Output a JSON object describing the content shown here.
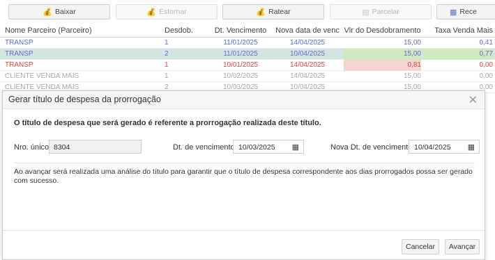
{
  "toolbar": {
    "buttons": [
      {
        "label": "Baixar",
        "icon": "money-bag-icon",
        "enabled": true
      },
      {
        "label": "Estornar",
        "icon": "money-bag-icon",
        "enabled": false
      },
      {
        "label": "Ratear",
        "icon": "money-bag-icon",
        "enabled": true
      },
      {
        "label": "Parcelar",
        "icon": "document-icon",
        "enabled": false
      },
      {
        "label": "Rece",
        "icon": "grid-icon",
        "enabled": true
      }
    ]
  },
  "grid": {
    "columns": [
      "Nome Parceiro (Parceiro)",
      "Desdob.",
      "Dt. Vencimento",
      "Nova data de venc",
      "Vlr do Desdobramento",
      "Taxa Venda Mais"
    ],
    "rows": [
      [
        "TRANSP",
        "1",
        "11/01/2025",
        "14/04/2025",
        "15,00",
        "0,41"
      ],
      [
        "TRANSP",
        "2",
        "11/01/2025",
        "10/04/2025",
        "15,00",
        "0,77"
      ],
      [
        "TRANSP",
        "1",
        "10/01/2025",
        "14/04/2025",
        "0,81",
        "0,00"
      ],
      [
        "CLIENTE VENDA MAIS",
        "1",
        "10/02/2025",
        "14/04/2025",
        "15,00",
        "0,00"
      ],
      [
        "CLIENTE VENDA MAIS",
        "2",
        "10/03/2025",
        "10/04/2025",
        "15,00",
        "0,00"
      ]
    ]
  },
  "modal": {
    "title": "Gerar título de despesa da prorrogação",
    "intro": "O título de despesa que será gerado é referente a prorrogação realizada deste título.",
    "nro_unico_label": "Nro. único:",
    "nro_unico_value": "8304",
    "dt_venc_label": "Dt. de vencimento:",
    "dt_venc_value": "10/03/2025",
    "nova_dt_label": "Nova Dt. de vencimento:",
    "nova_dt_value": "10/04/2025",
    "info": "Ao avançar será realizada uma análise do título para garantir que o título de despesa correspondente aos dias prorrogados possa ser gerado com sucesso.",
    "cancel_label": "Cancelar",
    "next_label": "Avançar"
  },
  "colors": {
    "link_blue": "#5c6bd6",
    "selected_row": "#d2e6e1",
    "negative_red": "#e2433a",
    "muted_gray": "#a9a9a9"
  }
}
